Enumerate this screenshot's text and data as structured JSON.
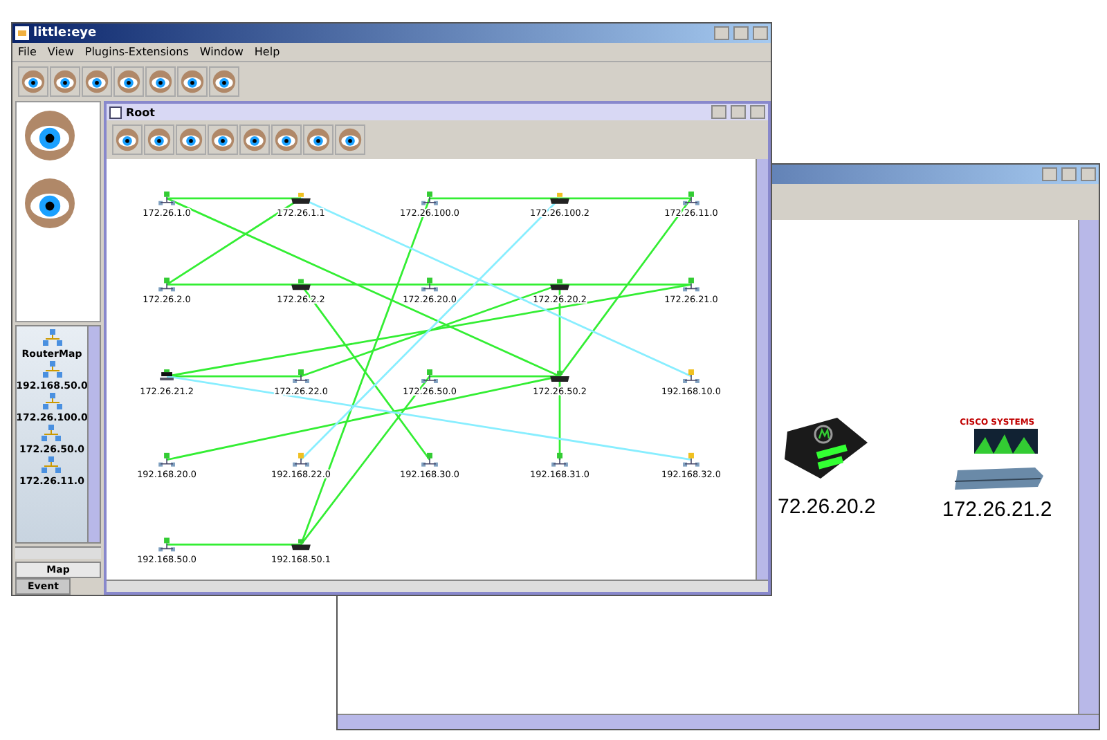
{
  "main_window": {
    "title": "little:eye",
    "menu": [
      "File",
      "View",
      "Plugins-Extensions",
      "Window",
      "Help"
    ]
  },
  "sidebar": {
    "items": [
      {
        "label": "RouterMap"
      },
      {
        "label": "192.168.50.0"
      },
      {
        "label": "172.26.100.0"
      },
      {
        "label": "172.26.50.0"
      },
      {
        "label": "172.26.11.0"
      }
    ],
    "tabs": [
      {
        "label": "Map",
        "selected": true
      },
      {
        "label": "Event",
        "selected": false
      }
    ]
  },
  "map_frame": {
    "title": "Root",
    "rows": [
      [
        {
          "label": "172.26.1.0",
          "kind": "network",
          "color": "#33cc33"
        },
        {
          "label": "172.26.1.1",
          "kind": "router",
          "color": "#f0c020"
        },
        {
          "label": "172.26.100.0",
          "kind": "network",
          "color": "#33cc33"
        },
        {
          "label": "172.26.100.2",
          "kind": "router",
          "color": "#f0c020"
        },
        {
          "label": "172.26.11.0",
          "kind": "network",
          "color": "#33cc33"
        }
      ],
      [
        {
          "label": "172.26.2.0",
          "kind": "network",
          "color": "#33cc33"
        },
        {
          "label": "172.26.2.2",
          "kind": "router",
          "color": "#33cc33"
        },
        {
          "label": "172.26.20.0",
          "kind": "network",
          "color": "#33cc33"
        },
        {
          "label": "172.26.20.2",
          "kind": "router",
          "color": "#33cc33"
        },
        {
          "label": "172.26.21.0",
          "kind": "network",
          "color": "#33cc33"
        }
      ],
      [
        {
          "label": "172.26.21.2",
          "kind": "switch",
          "color": "#33cc33"
        },
        {
          "label": "172.26.22.0",
          "kind": "network",
          "color": "#33cc33"
        },
        {
          "label": "172.26.50.0",
          "kind": "network",
          "color": "#33cc33"
        },
        {
          "label": "172.26.50.2",
          "kind": "router",
          "color": "#33cc33"
        },
        {
          "label": "192.168.10.0",
          "kind": "network",
          "color": "#f0c020"
        }
      ],
      [
        {
          "label": "192.168.20.0",
          "kind": "network",
          "color": "#33cc33"
        },
        {
          "label": "192.168.22.0",
          "kind": "network",
          "color": "#f0c020"
        },
        {
          "label": "192.168.30.0",
          "kind": "network",
          "color": "#33cc33"
        },
        {
          "label": "192.168.31.0",
          "kind": "network",
          "color": "#33cc33"
        },
        {
          "label": "192.168.32.0",
          "kind": "network",
          "color": "#f0c020"
        }
      ],
      [
        {
          "label": "192.168.50.0",
          "kind": "network",
          "color": "#33cc33"
        },
        {
          "label": "192.168.50.1",
          "kind": "router",
          "color": "#33cc33"
        }
      ]
    ]
  },
  "device_window": {
    "devices": [
      {
        "kind": "modem",
        "label": "72.26.20.2"
      },
      {
        "kind": "router",
        "logo": "CISCO SYSTEMS",
        "label": "172.26.21.2"
      }
    ]
  }
}
